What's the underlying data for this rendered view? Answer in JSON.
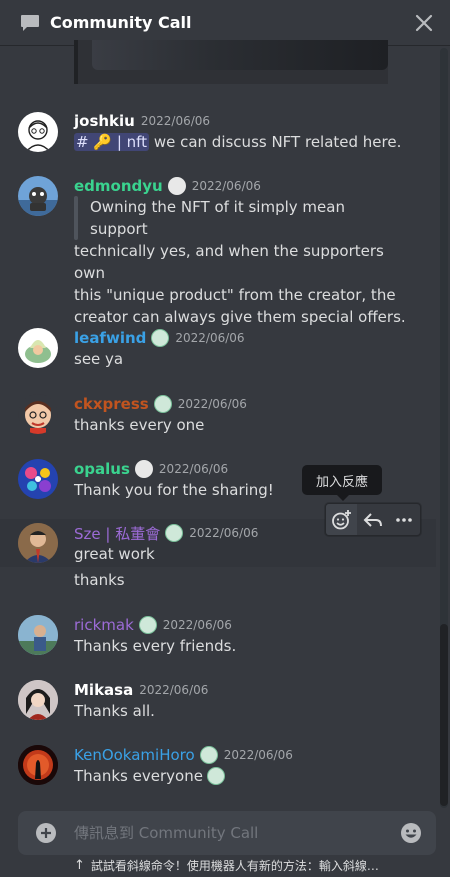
{
  "header": {
    "title": "Community Call"
  },
  "messages": [
    {
      "user": "joshkiu",
      "user_color": "#ffffff",
      "timestamp": "2022/06/06",
      "channel_mention": "nft",
      "text": "we can discuss NFT related here."
    },
    {
      "user": "edmondyu",
      "user_color": "#3ad38f",
      "timestamp": "2022/06/06",
      "quote_line1": "Owning the NFT of it simply mean",
      "quote_line2": "support",
      "line1": "technically yes, and when the supporters own",
      "line2": "this \"unique product\" from the creator, the",
      "line3": "creator can always give them special offers."
    },
    {
      "user": "leafwind",
      "user_color": "#3aa1e6",
      "timestamp": "2022/06/06",
      "text": "see ya"
    },
    {
      "user": "ckxpress",
      "user_color": "#c2541f",
      "timestamp": "2022/06/06",
      "text": "thanks every one"
    },
    {
      "user": "opalus",
      "user_color": "#3ad38f",
      "timestamp": "2022/06/06",
      "text": "Thank you for the sharing!"
    },
    {
      "user": "Sze | 私董會",
      "user_color": "#9c6bd6",
      "timestamp": "2022/06/06",
      "text": "great work",
      "text2": "thanks"
    },
    {
      "user": "rickmak",
      "user_color": "#9c6bd6",
      "timestamp": "2022/06/06",
      "text": "Thanks every friends."
    },
    {
      "user": "Mikasa",
      "user_color": "#ffffff",
      "timestamp": "2022/06/06",
      "text": "Thanks all."
    },
    {
      "user": "KenOokamiHoro",
      "user_color": "#3aa1e6",
      "timestamp": "2022/06/06",
      "text": "Thanks everyone"
    }
  ],
  "tooltip": {
    "label": "加入反應"
  },
  "composer": {
    "placeholder": "傳訊息到 Community Call"
  },
  "hint": {
    "text": "試試看斜線命令！使用機器人有新的方法：輸入斜線…"
  },
  "colors": {
    "background": "#36393f",
    "input": "#40444b",
    "mention_bg": "#414675",
    "timestamp": "#a3a6aa"
  }
}
